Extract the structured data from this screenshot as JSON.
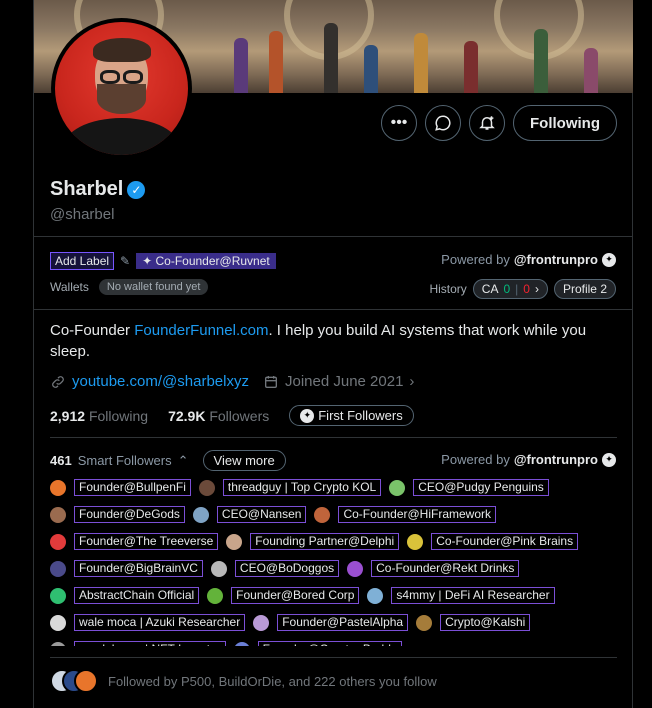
{
  "profile": {
    "name": "Sharbel",
    "handle": "@sharbel",
    "verified_mark": "✓",
    "following_label": "Following",
    "bio_prefix": "Co-Founder ",
    "bio_link": "FounderFunnel.com",
    "bio_suffix": ". I help you build AI systems that work while you sleep.",
    "website": "youtube.com/@sharbelxyz",
    "joined": "Joined June 2021",
    "following_count": "2,912",
    "following_label_text": "Following",
    "followers_count": "72.9K",
    "followers_label_text": "Followers",
    "first_followers": "First Followers"
  },
  "icons": {
    "more": "more-icon",
    "message": "message-icon",
    "notify": "bell-plus-icon",
    "link": "link-icon",
    "calendar": "calendar-icon"
  },
  "frontrun": {
    "add_label": "Add Label",
    "co_founder_tag": "✦ Co-Founder@Ruvnet",
    "powered_by": "Powered by",
    "brand": "@frontrunpro",
    "wallets_label": "Wallets",
    "no_wallet": "No wallet found yet",
    "history_label": "History",
    "ca_label": "CA",
    "ca_green": "0",
    "ca_red": "0",
    "profile_pill": "Profile 2"
  },
  "smart": {
    "count": "461",
    "label": "Smart Followers",
    "view_more": "View more",
    "powered_by": "Powered by",
    "brand": "@frontrunpro",
    "rows": [
      [
        {
          "label": "Founder@BullpenFi",
          "color": "#e8752b"
        },
        {
          "label": "threadguy | Top Crypto KOL",
          "color": "#6b4a3a"
        },
        {
          "label": "CEO@Pudgy Penguins",
          "color": "#7ac36a"
        }
      ],
      [
        {
          "label": "Founder@DeGods",
          "color": "#9a6b4f"
        },
        {
          "label": "CEO@Nansen",
          "color": "#7fa3c4"
        },
        {
          "label": "Co-Founder@HiFramework",
          "color": "#c0643b"
        }
      ],
      [
        {
          "label": "Founder@The Treeverse",
          "color": "#e23b3b"
        },
        {
          "label": "Founding Partner@Delphi",
          "color": "#c9a58b"
        },
        {
          "label": "Co-Founder@Pink Brains",
          "color": "#d9c23a"
        }
      ],
      [
        {
          "label": "Founder@BigBrainVC",
          "color": "#4a4a8a"
        },
        {
          "label": "CEO@BoDoggos",
          "color": "#b8b8b8"
        },
        {
          "label": "Co-Founder@Rekt Drinks",
          "color": "#9a4fd0"
        }
      ],
      [
        {
          "label": "AbstractChain Official",
          "color": "#2fbf71"
        },
        {
          "label": "Founder@Bored Corp",
          "color": "#63b33a"
        },
        {
          "label": "s4mmy | DeFi AI Researcher",
          "color": "#7fb0d6"
        }
      ],
      [
        {
          "label": "wale moca | Azuki Researcher",
          "color": "#d9d9d9"
        },
        {
          "label": "Founder@PastelAlpha",
          "color": "#b99ad6"
        },
        {
          "label": "Crypto@Kalshi",
          "color": "#a57c3a"
        }
      ],
      [
        {
          "label": "seedphrase | NFT Investor",
          "color": "#9a9a9a"
        },
        {
          "label": "Founder@Creator Buddy",
          "color": "#6a7fd6"
        }
      ]
    ]
  },
  "followed_by": "Followed by P500, BuildOrDie, and 222 others you follow"
}
